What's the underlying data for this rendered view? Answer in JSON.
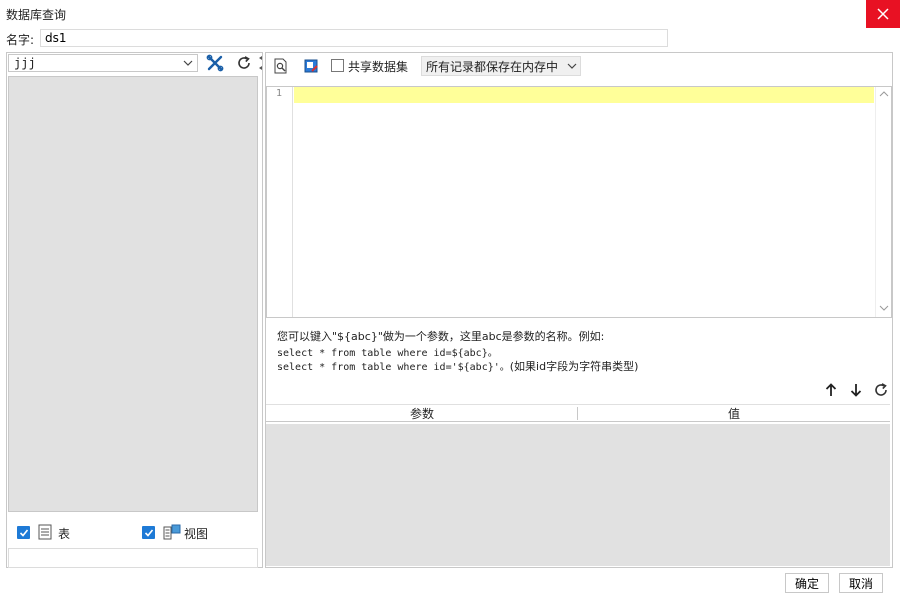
{
  "window": {
    "title": "数据库查询"
  },
  "name_field": {
    "label": "名字:",
    "value": "ds1"
  },
  "left": {
    "datasource": "jjj",
    "tables_label": "表",
    "views_label": "视图",
    "tables_checked": true,
    "views_checked": true
  },
  "toolbar": {
    "shared_label": "共享数据集",
    "cache_mode": "所有记录都保存在内存中"
  },
  "editor": {
    "line_numbers": [
      "1"
    ]
  },
  "hint": {
    "line1": "您可以键入\"${abc}\"做为一个参数，这里abc是参数的名称。例如:",
    "line2": "select * from table where id=${abc}。",
    "line3_code": "select * from table where id='${abc}'。",
    "line3_note": "(如果id字段为字符串类型)"
  },
  "params": {
    "col_param": "参数",
    "col_value": "值"
  },
  "footer": {
    "ok": "确定",
    "cancel": "取消"
  },
  "colors": {
    "accent": "#1e7ad6",
    "close": "#e81123",
    "active_line": "#ffff99",
    "panel_gray": "#e1e1e1"
  }
}
